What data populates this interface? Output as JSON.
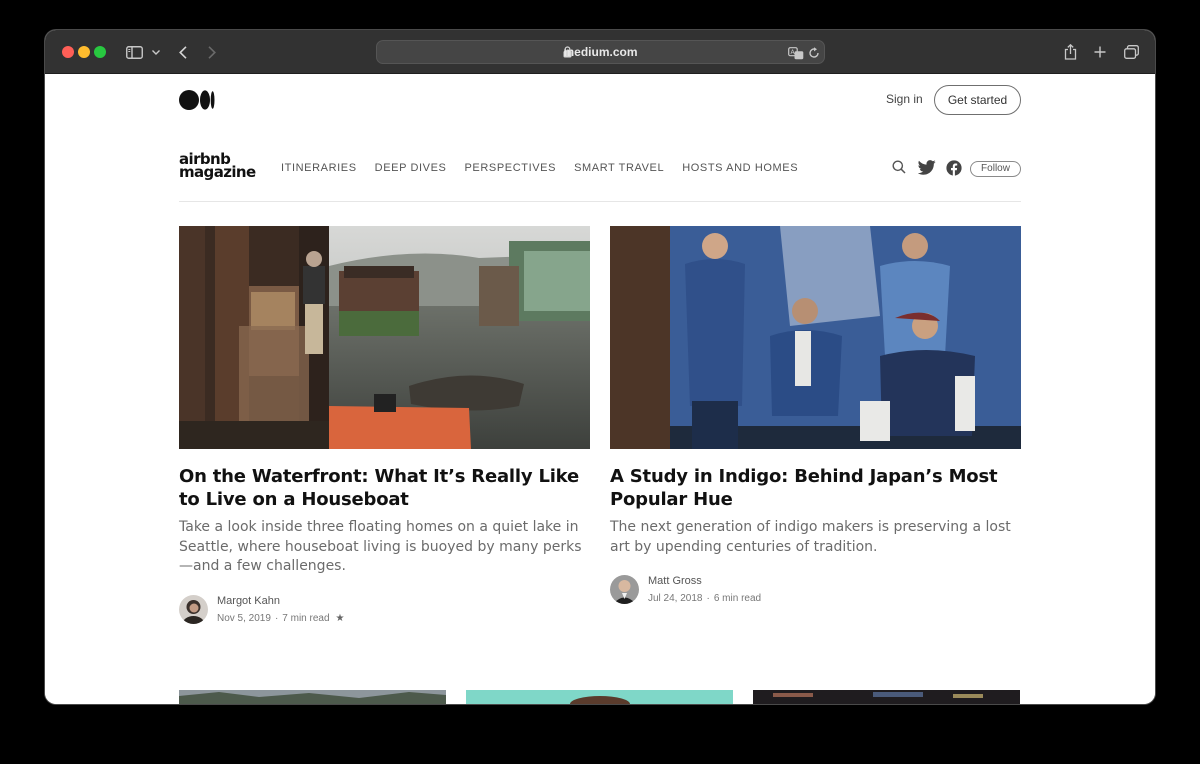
{
  "browser": {
    "url": "medium.com",
    "traffic_lights": {
      "close": "#ff5f57",
      "minimize": "#febc2e",
      "zoom": "#28c840"
    },
    "icons": [
      "sidebar-icon",
      "chevron-down-icon",
      "back-icon",
      "forward-icon",
      "lock-icon",
      "translate-icon",
      "reload-icon",
      "share-icon",
      "new-tab-icon",
      "tabs-overview-icon"
    ]
  },
  "header": {
    "signin_label": "Sign in",
    "get_started_label": "Get started"
  },
  "publication": {
    "logo_line1": "airbnb",
    "logo_line2": "magazine",
    "nav": [
      "ITINERARIES",
      "DEEP DIVES",
      "PERSPECTIVES",
      "SMART TRAVEL",
      "HOSTS AND HOMES"
    ],
    "follow_label": "Follow",
    "icons": [
      "search-icon",
      "twitter-icon",
      "facebook-icon"
    ]
  },
  "articles": [
    {
      "title": "On the Waterfront: What It’s Really Like to Live on a Houseboat",
      "description": "Take a look inside three floating homes on a quiet lake in Seattle, where houseboat living is buoyed by many perks—and a few challenges.",
      "author": "Margot Kahn",
      "date": "Nov 5, 2019",
      "read_time": "7 min read",
      "starred": true
    },
    {
      "title": "A Study in Indigo: Behind Japan’s Most Popular Hue",
      "description": "The next generation of indigo makers is preserving a lost art by upending centuries of tradition.",
      "author": "Matt Gross",
      "date": "Jul 24, 2018",
      "read_time": "6 min read",
      "starred": false
    }
  ],
  "colors": {
    "titlebar": "#323232",
    "text_primary": "#111111",
    "text_secondary": "#6b6b6b"
  }
}
